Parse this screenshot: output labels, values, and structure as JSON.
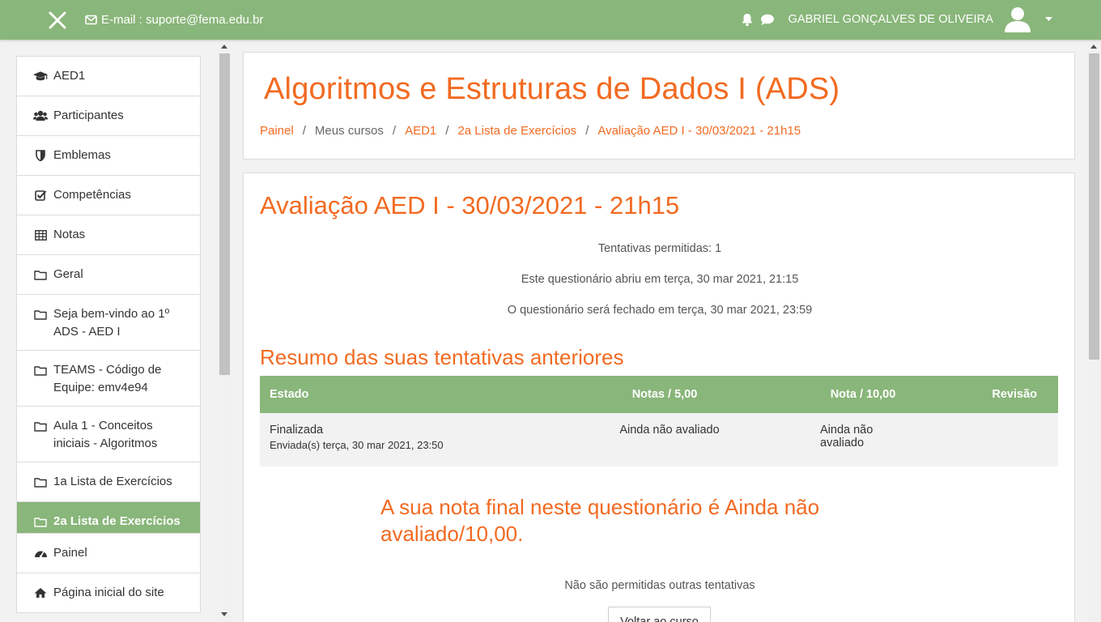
{
  "navbar": {
    "email": "E-mail : suporte@fema.edu.br",
    "user_name": "GABRIEL GONÇALVES DE OLIVEIRA",
    "icons": [
      "close-icon",
      "envelope-icon",
      "bell-icon",
      "chat-icon",
      "user-avatar-icon",
      "caret-down-icon"
    ]
  },
  "sidebar": {
    "items": [
      {
        "label": "AED1",
        "icon": "graduation-cap-icon"
      },
      {
        "label": "Participantes",
        "icon": "users-icon"
      },
      {
        "label": "Emblemas",
        "icon": "shield-icon"
      },
      {
        "label": "Competências",
        "icon": "checkbox-icon"
      },
      {
        "label": "Notas",
        "icon": "table-icon"
      },
      {
        "label": "Geral",
        "icon": "folder-icon"
      },
      {
        "label": "Seja bem-vindo ao 1º ADS - AED I",
        "icon": "folder-icon"
      },
      {
        "label": "TEAMS - Código de Equipe: emv4e94",
        "icon": "folder-icon"
      },
      {
        "label": "Aula 1 - Conceitos iniciais - Algoritmos",
        "icon": "folder-icon"
      },
      {
        "label": "1a Lista de Exercícios",
        "icon": "folder-icon"
      },
      {
        "label": "2a Lista de Exercícios",
        "icon": "folder-icon",
        "active": true
      }
    ],
    "items2": [
      {
        "label": "Painel",
        "icon": "dashboard-icon"
      },
      {
        "label": "Página inicial do site",
        "icon": "home-icon"
      }
    ]
  },
  "header": {
    "course_title": "Algoritmos e Estruturas de Dados I (ADS)",
    "breadcrumb": [
      "Painel",
      "Meus cursos",
      "AED1",
      "2a Lista de Exercícios",
      "Avaliação AED I - 30/03/2021 - 21h15"
    ]
  },
  "quiz": {
    "title": "Avaliação AED I - 30/03/2021 - 21h15",
    "attempts_allowed": "Tentativas permitidas: 1",
    "opened": "Este questionário abriu em terça, 30 mar 2021, 21:15",
    "closes": "O questionário será fechado em terça, 30 mar 2021, 23:59",
    "summary_title": "Resumo das suas tentativas anteriores",
    "table": {
      "headers": [
        "Estado",
        "Notas / 5,00",
        "Nota / 10,00",
        "Revisão"
      ],
      "rows": [
        {
          "state": "Finalizada",
          "submitted": "Enviada(s) terça, 30 mar 2021, 23:50",
          "marks": "Ainda não avaliado",
          "grade": "Ainda não avaliado",
          "review": ""
        }
      ]
    },
    "final_grade": "A sua nota final neste questionário é Ainda não avaliado/10,00.",
    "no_more_attempts": "Não são permitidas outras tentativas",
    "back_button": "Voltar ao curso"
  },
  "colors": {
    "brand_green": "#89b67a",
    "accent_orange": "#f26a21"
  }
}
